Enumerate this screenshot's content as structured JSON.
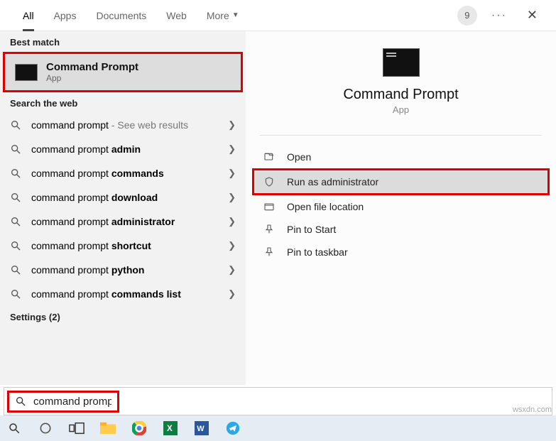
{
  "tabs": {
    "all": "All",
    "apps": "Apps",
    "documents": "Documents",
    "web": "Web",
    "more": "More"
  },
  "badge": "9",
  "sections": {
    "best_match": "Best match",
    "search_web": "Search the web",
    "settings": "Settings (2)"
  },
  "best": {
    "title": "Command Prompt",
    "subtitle": "App"
  },
  "web_results": [
    {
      "prefix": "command prompt",
      "bold": "",
      "suffix": " - See web results"
    },
    {
      "prefix": "command prompt ",
      "bold": "admin",
      "suffix": ""
    },
    {
      "prefix": "command prompt ",
      "bold": "commands",
      "suffix": ""
    },
    {
      "prefix": "command prompt ",
      "bold": "download",
      "suffix": ""
    },
    {
      "prefix": "command prompt ",
      "bold": "administrator",
      "suffix": ""
    },
    {
      "prefix": "command prompt ",
      "bold": "shortcut",
      "suffix": ""
    },
    {
      "prefix": "command prompt ",
      "bold": "python",
      "suffix": ""
    },
    {
      "prefix": "command prompt ",
      "bold": "commands list",
      "suffix": ""
    }
  ],
  "preview": {
    "title": "Command Prompt",
    "subtitle": "App"
  },
  "actions": {
    "open": "Open",
    "run_admin": "Run as administrator",
    "open_loc": "Open file location",
    "pin_start": "Pin to Start",
    "pin_taskbar": "Pin to taskbar"
  },
  "search_value": "command prompt",
  "watermark": "wsxdn.com"
}
